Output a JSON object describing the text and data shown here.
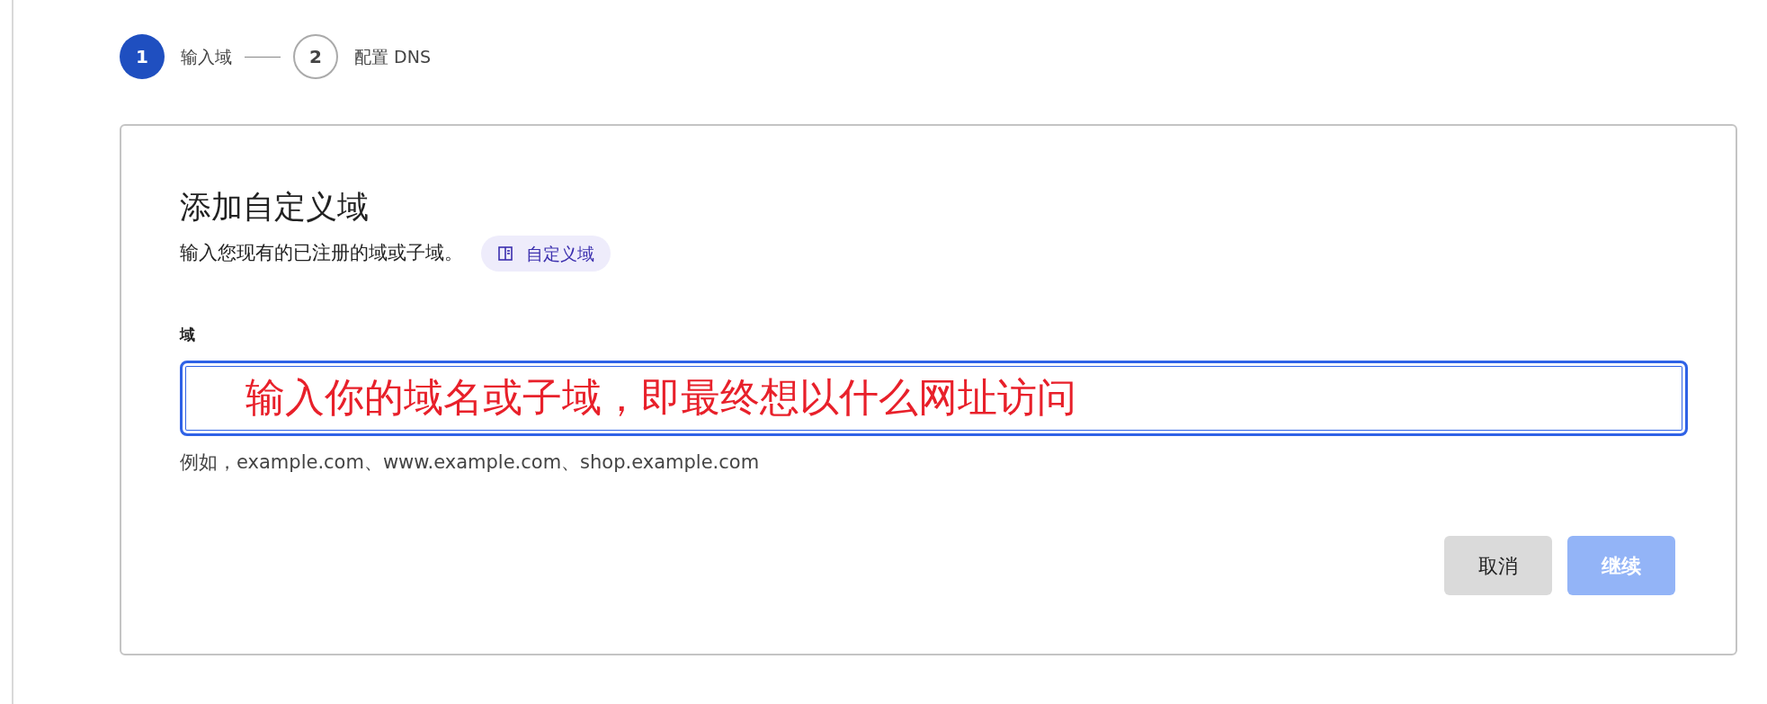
{
  "steps": [
    {
      "number": "1",
      "label": "输入域",
      "selected": true
    },
    {
      "number": "2",
      "label": "配置 DNS",
      "selected": false
    }
  ],
  "card": {
    "title": "添加自定义域",
    "description": "输入您现有的已注册的域或子域。",
    "doc_link": "自定义域",
    "field": {
      "label": "域",
      "value": "输入你的域名或子域，即最终想以什么网址访问",
      "focused": true,
      "help": "例如，example.com、www.example.com、shop.example.com"
    },
    "buttons": [
      {
        "label": "取消",
        "kind": "secondary",
        "disabled": false
      },
      {
        "label": "继续",
        "kind": "primary",
        "disabled": true
      }
    ]
  }
}
